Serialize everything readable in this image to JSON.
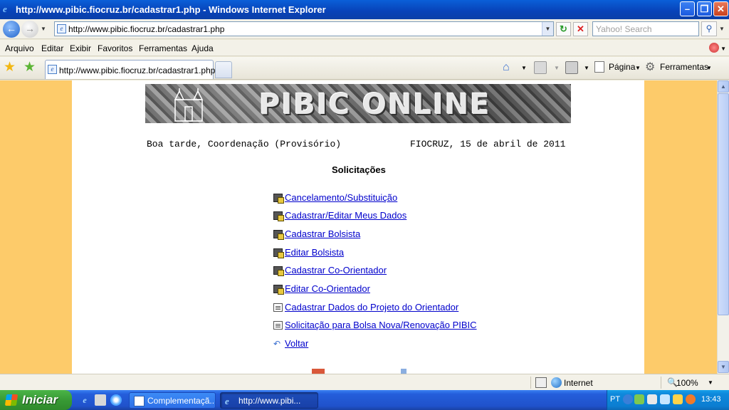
{
  "window": {
    "title": "http://www.pibic.fiocruz.br/cadastrar1.php - Windows Internet Explorer"
  },
  "address_bar": {
    "url": "http://www.pibic.fiocruz.br/cadastrar1.php",
    "search_placeholder": "Yahoo! Search"
  },
  "menu": {
    "items": [
      "Arquivo",
      "Editar",
      "Exibir",
      "Favoritos",
      "Ferramentas",
      "Ajuda"
    ]
  },
  "tabs": [
    {
      "label": "http://www.pibic.fiocruz.br/cadastrar1.php"
    }
  ],
  "toolbar": {
    "page_label": "Página",
    "tools_label": "Ferramentas"
  },
  "page": {
    "banner_title": "PIBIC ONLINE",
    "greeting": "Boa tarde, Coordenação (Provisório)",
    "date_line": "FIOCRUZ, 15 de abril de 2011",
    "heading": "Solicitações",
    "links": [
      {
        "label": "Cancelamento/Substituição",
        "icon": "edit-form-icon"
      },
      {
        "label": "Cadastrar/Editar Meus Dados",
        "icon": "edit-form-icon"
      },
      {
        "label": "Cadastrar Bolsista",
        "icon": "edit-form-icon"
      },
      {
        "label": "Editar Bolsista",
        "icon": "edit-form-icon"
      },
      {
        "label": "Cadastrar Co-Orientador",
        "icon": "edit-form-icon"
      },
      {
        "label": "Editar Co-Orientador",
        "icon": "edit-form-icon"
      },
      {
        "label": "Cadastrar Dados do Projeto do Orientador",
        "icon": "document-icon"
      },
      {
        "label": "Solicitação para Bolsa Nova/Renovação PIBIC",
        "icon": "document-icon"
      },
      {
        "label": "Voltar",
        "icon": "back-arrow-icon"
      }
    ]
  },
  "status_bar": {
    "zone": "Internet",
    "zoom": "100%"
  },
  "taskbar": {
    "start_label": "Iniciar",
    "tasks": [
      {
        "label": "Complementaçã..."
      },
      {
        "label": "http://www.pibi..."
      }
    ],
    "language": "PT",
    "clock": "13:43"
  },
  "colors": {
    "page_side_background": "#FDCB6A",
    "link_color": "#0000CC",
    "titlebar_blue": "#0842B8",
    "start_green": "#389A35"
  }
}
